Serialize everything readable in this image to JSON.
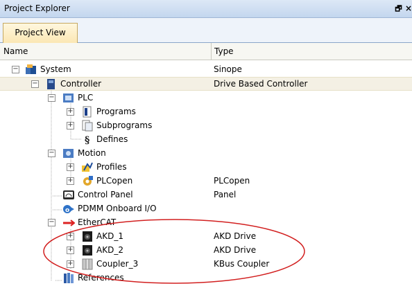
{
  "window": {
    "title": "Project Explorer",
    "restore_glyph": "🗗",
    "close_glyph": "×"
  },
  "tabs": [
    {
      "label": "Project View"
    }
  ],
  "columns": {
    "name": "Name",
    "type": "Type"
  },
  "tree": {
    "system": {
      "label": "System",
      "type": "Sinope"
    },
    "controller": {
      "label": "Controller",
      "type": "Drive Based Controller"
    },
    "plc": {
      "label": "PLC",
      "type": ""
    },
    "programs": {
      "label": "Programs",
      "type": ""
    },
    "subprograms": {
      "label": "Subprograms",
      "type": ""
    },
    "defines": {
      "label": "Defines",
      "type": ""
    },
    "motion": {
      "label": "Motion",
      "type": ""
    },
    "profiles": {
      "label": "Profiles",
      "type": ""
    },
    "plcopen": {
      "label": "PLCopen",
      "type": "PLCopen"
    },
    "control_panel": {
      "label": "Control Panel",
      "type": "Panel"
    },
    "pdmm_io": {
      "label": "PDMM Onboard I/O",
      "type": ""
    },
    "ethercat": {
      "label": "EtherCAT",
      "type": ""
    },
    "akd1": {
      "label": "AKD_1",
      "type": "AKD Drive"
    },
    "akd2": {
      "label": "AKD_2",
      "type": "AKD Drive"
    },
    "coupler3": {
      "label": "Coupler_3",
      "type": "KBus Coupler"
    },
    "references": {
      "label": "References",
      "type": ""
    }
  },
  "colors": {
    "highlight_ellipse": "#d21f1f",
    "selected_row": "#f4f0e4",
    "titlebar": "#c3d6ee"
  }
}
